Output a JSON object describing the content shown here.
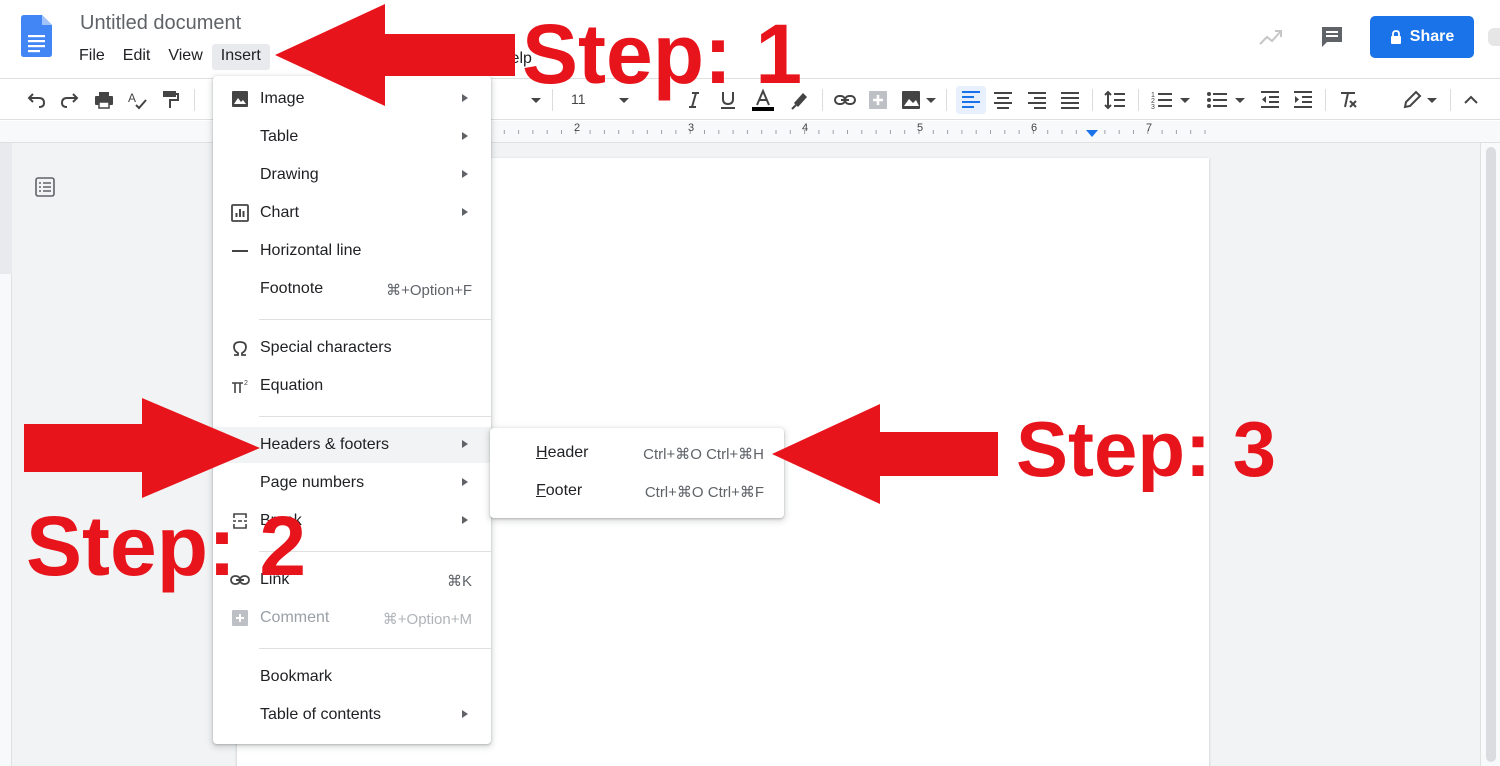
{
  "app": {
    "title": "Untitled document",
    "menus": [
      "File",
      "Edit",
      "View",
      "Insert",
      "Help"
    ],
    "share_label": "Share"
  },
  "toolbar": {
    "font_size": "11"
  },
  "ruler": {
    "numbers": [
      "2",
      "3",
      "4",
      "5",
      "6",
      "7"
    ]
  },
  "insert_menu": {
    "items": [
      {
        "label": "Image",
        "icon": "image-icon",
        "submenu": true
      },
      {
        "label": "Table",
        "submenu": true
      },
      {
        "label": "Drawing",
        "submenu": true
      },
      {
        "label": "Chart",
        "icon": "chart-icon",
        "submenu": true
      },
      {
        "label": "Horizontal line",
        "icon": "horizontal-line-icon"
      },
      {
        "label": "Footnote",
        "shortcut": "⌘+Option+F"
      },
      {
        "label": "Special characters",
        "icon": "omega-icon"
      },
      {
        "label": "Equation",
        "icon": "pi-icon"
      },
      {
        "label": "Headers & footers",
        "submenu": true,
        "highlighted": true
      },
      {
        "label": "Page numbers",
        "submenu": true
      },
      {
        "label": "Break",
        "icon": "break-icon",
        "submenu": true
      },
      {
        "label": "Link",
        "icon": "link-icon",
        "shortcut": "⌘K"
      },
      {
        "label": "Comment",
        "icon": "comment-add-icon",
        "shortcut": "⌘+Option+M",
        "disabled": true
      },
      {
        "label": "Bookmark"
      },
      {
        "label": "Table of contents",
        "submenu": true
      }
    ]
  },
  "submenu": {
    "header_label_u": "H",
    "header_label_rest": "eader",
    "header_shortcut": "Ctrl+⌘O Ctrl+⌘H",
    "footer_label_u": "F",
    "footer_label_rest": "ooter",
    "footer_shortcut": "Ctrl+⌘O Ctrl+⌘F"
  },
  "annotations": {
    "step1": "Step: 1",
    "step2": "Step: 2",
    "step3": "Step: 3",
    "color": "#e8141c"
  },
  "colors": {
    "accent": "#1a73e8",
    "doc_icon": "#4285f4"
  }
}
